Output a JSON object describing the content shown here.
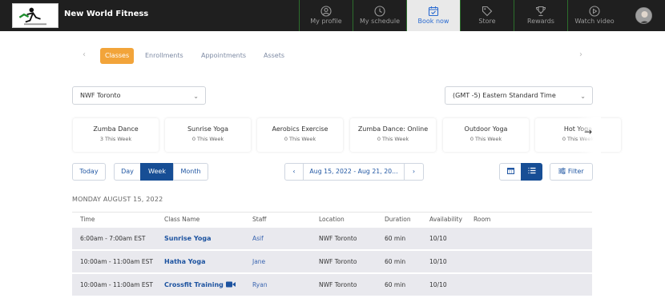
{
  "header": {
    "brand": "New World Fitness",
    "nav": [
      {
        "label": "My profile",
        "icon": "profile-icon"
      },
      {
        "label": "My schedule",
        "icon": "clock-icon"
      },
      {
        "label": "Book now",
        "icon": "calendar-check-icon",
        "active": true
      },
      {
        "label": "Store",
        "icon": "tag-icon"
      },
      {
        "label": "Rewards",
        "icon": "trophy-icon"
      },
      {
        "label": "Watch video",
        "icon": "play-icon"
      }
    ]
  },
  "subtabs": [
    "Classes",
    "Enrollments",
    "Appointments",
    "Assets"
  ],
  "filters": {
    "location": "NWF Toronto",
    "timezone": "(GMT -5) Eastern Standard Time"
  },
  "cards": [
    {
      "title": "Zumba Dance",
      "count": "3 This Week"
    },
    {
      "title": "Sunrise Yoga",
      "count": "0 This Week"
    },
    {
      "title": "Aerobics Exercise",
      "count": "0 This Week"
    },
    {
      "title": "Zumba Dance: Online",
      "count": "0 This Week"
    },
    {
      "title": "Outdoor Yoga",
      "count": "0 This Week"
    },
    {
      "title": "Hot Yoga",
      "count": "0 This Week"
    }
  ],
  "controls": {
    "today": "Today",
    "day": "Day",
    "week": "Week",
    "month": "Month",
    "range": "Aug 15, 2022 - Aug 21, 20...",
    "filter": "Filter"
  },
  "day_label": "MONDAY AUGUST 15, 2022",
  "table": {
    "headers": [
      "Time",
      "Class Name",
      "Staff",
      "Location",
      "Duration",
      "Availability",
      "Room"
    ],
    "rows": [
      {
        "time": "6:00am - 7:00am EST",
        "class": "Sunrise Yoga",
        "staff": "Asif",
        "location": "NWF Toronto",
        "duration": "60 min",
        "availability": "10/10"
      },
      {
        "time": "10:00am - 11:00am EST",
        "class": "Hatha Yoga",
        "staff": "Jane",
        "location": "NWF Toronto",
        "duration": "60 min",
        "availability": "10/10"
      },
      {
        "time": "10:00am - 11:00am EST",
        "class": "Crossfit Training",
        "staff": "Ryan",
        "location": "NWF Toronto",
        "duration": "60 min",
        "availability": "10/10"
      }
    ]
  }
}
